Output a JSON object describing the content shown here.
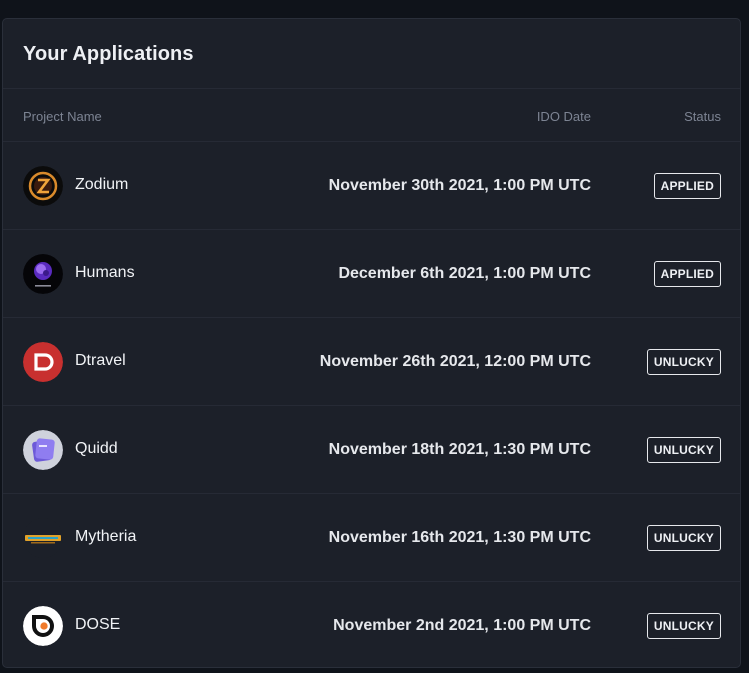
{
  "panel": {
    "title": "Your Applications"
  },
  "table": {
    "columns": {
      "project_name": "Project Name",
      "ido_date": "IDO Date",
      "status": "Status"
    },
    "rows": [
      {
        "logo_icon": "zodium-logo-icon",
        "name": "Zodium",
        "date": "November 30th 2021, 1:00 PM UTC",
        "status": "APPLIED"
      },
      {
        "logo_icon": "humans-logo-icon",
        "name": "Humans",
        "date": "December 6th 2021, 1:00 PM UTC",
        "status": "APPLIED"
      },
      {
        "logo_icon": "dtravel-logo-icon",
        "name": "Dtravel",
        "date": "November 26th 2021, 12:00 PM UTC",
        "status": "UNLUCKY"
      },
      {
        "logo_icon": "quidd-logo-icon",
        "name": "Quidd",
        "date": "November 18th 2021, 1:30 PM UTC",
        "status": "UNLUCKY"
      },
      {
        "logo_icon": "mytheria-logo-icon",
        "name": "Mytheria",
        "date": "November 16th 2021, 1:30 PM UTC",
        "status": "UNLUCKY"
      },
      {
        "logo_icon": "dose-logo-icon",
        "name": "DOSE",
        "date": "November 2nd 2021, 1:00 PM UTC",
        "status": "UNLUCKY"
      }
    ]
  },
  "colors": {
    "page_background": "#0f131a",
    "panel_background": "#1c2029",
    "divider": "#262a35",
    "muted_text": "#7d8493",
    "primary_text": "#eef0f4"
  }
}
